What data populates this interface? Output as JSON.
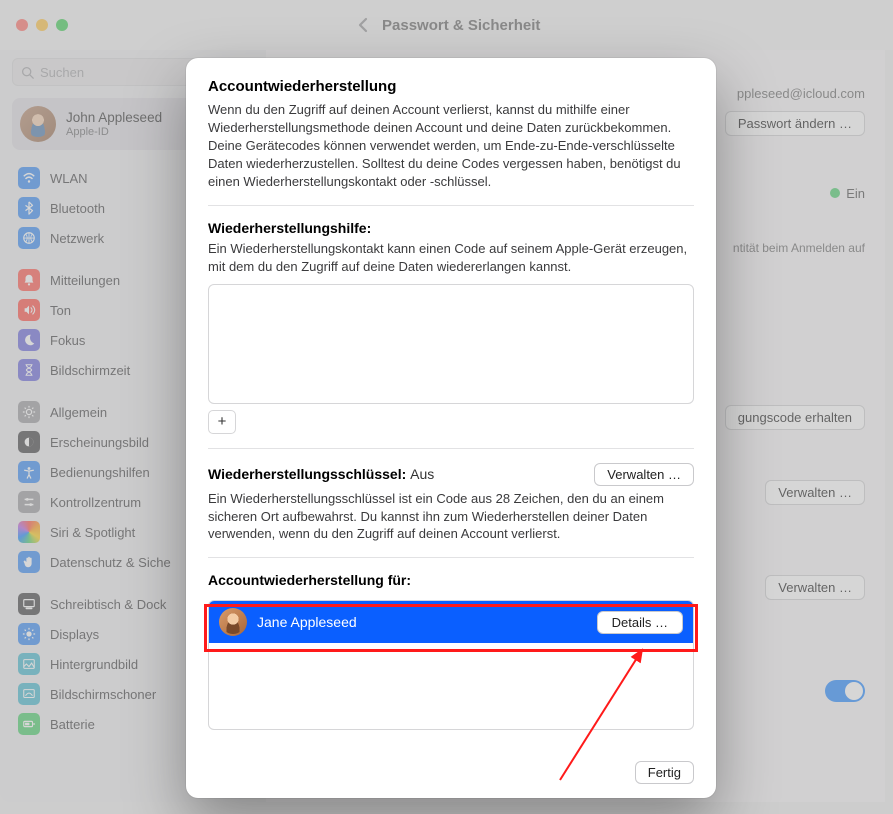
{
  "titlebar": {
    "title": "Passwort & Sicherheit"
  },
  "search": {
    "placeholder": "Suchen"
  },
  "user": {
    "name": "John Appleseed",
    "sub": "Apple-ID"
  },
  "sidebar": {
    "g1": [
      {
        "label": "WLAN",
        "ic": "ic-blue"
      },
      {
        "label": "Bluetooth",
        "ic": "ic-blue"
      },
      {
        "label": "Netzwerk",
        "ic": "ic-blue"
      }
    ],
    "g2": [
      {
        "label": "Mitteilungen",
        "ic": "ic-red"
      },
      {
        "label": "Ton",
        "ic": "ic-red2"
      },
      {
        "label": "Fokus",
        "ic": "ic-indigo"
      },
      {
        "label": "Bildschirmzeit",
        "ic": "ic-indigo"
      }
    ],
    "g3": [
      {
        "label": "Allgemein",
        "ic": "ic-gray"
      },
      {
        "label": "Erscheinungsbild",
        "ic": "ic-black"
      },
      {
        "label": "Bedienungshilfen",
        "ic": "ic-blue"
      },
      {
        "label": "Kontrollzentrum",
        "ic": "ic-gray"
      },
      {
        "label": "Siri & Spotlight",
        "ic": "ic-multi"
      },
      {
        "label": "Datenschutz & Sicherheit",
        "ic": "ic-blue"
      }
    ],
    "g4": [
      {
        "label": "Schreibtisch & Dock",
        "ic": "ic-black"
      },
      {
        "label": "Displays",
        "ic": "ic-blue"
      },
      {
        "label": "Hintergrundbild",
        "ic": "ic-teal"
      },
      {
        "label": "Bildschirmschoner",
        "ic": "ic-teal"
      },
      {
        "label": "Batterie",
        "ic": "ic-green"
      }
    ],
    "truncated_security": "Datenschutz & Siche"
  },
  "bg": {
    "email": "ppleseed@icloud.com",
    "btn_change_pw": "Passwort ändern …",
    "on_label": "Ein",
    "identity_hint": "ntität beim Anmelden auf",
    "code_btn": "gungscode erhalten",
    "manage1": "Verwalten …",
    "manage2": "Verwalten …"
  },
  "modal": {
    "h1": "Accountwiederherstellung",
    "p1": "Wenn du den Zugriff auf deinen Account verlierst, kannst du mithilfe einer Wiederherstellungsmethode deinen Account und deine Daten zurückbekommen. Deine Gerätecodes können verwendet werden, um Ende-zu-Ende-verschlüsselte Daten wiederherzustellen. Solltest du deine Codes vergessen haben, benötigst du einen Wiederherstellungskontakt oder -schlüssel.",
    "h2": "Wiederherstellungshilfe:",
    "p2": "Ein Wiederherstellungskontakt kann einen Code auf seinem Apple-Gerät erzeugen, mit dem du den Zugriff auf deine Daten wiedererlangen kannst.",
    "add_label": "+",
    "key_h": "Wiederherstellungsschlüssel:",
    "key_status": "Aus",
    "manage": "Verwalten …",
    "key_p": "Ein Wiederherstellungsschlüssel ist ein Code aus 28 Zeichen, den du an einem sicheren Ort aufbewahrst. Du kannst ihn zum Wiederherstellen deiner Daten verwenden, wenn du den Zugriff auf deinen Account verlierst.",
    "for_h": "Accountwiederherstellung für:",
    "contact": {
      "name": "Jane Appleseed",
      "details": "Details …"
    },
    "done": "Fertig"
  }
}
